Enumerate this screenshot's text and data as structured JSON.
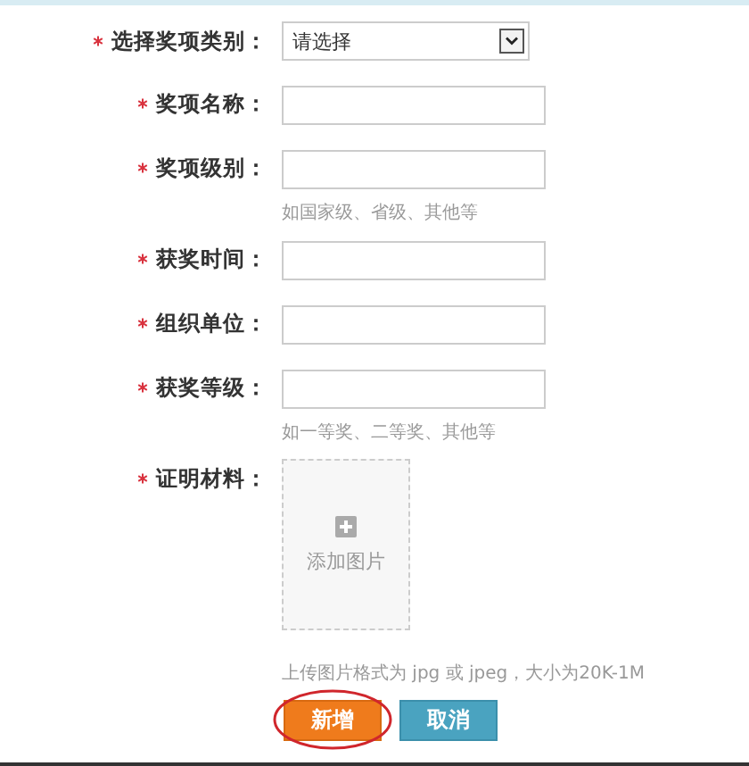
{
  "fields": [
    {
      "kind": "select",
      "label": "选择奖项类别：",
      "required": true,
      "value": "请选择"
    },
    {
      "kind": "text",
      "label": "奖项名称：",
      "required": true
    },
    {
      "kind": "text",
      "label": "奖项级别：",
      "required": true,
      "hint": "如国家级、省级、其他等"
    },
    {
      "kind": "text",
      "label": "获奖时间：",
      "required": true
    },
    {
      "kind": "text",
      "label": "组织单位：",
      "required": true
    },
    {
      "kind": "text",
      "label": "获奖等级：",
      "required": true,
      "hint": "如一等奖、二等奖、其他等"
    },
    {
      "kind": "upload",
      "label": "证明材料：",
      "required": true,
      "button": "添加图片"
    }
  ],
  "upload_hint": "上传图片格式为 jpg 或 jpeg，大小为20K-1M",
  "buttons": [
    {
      "label": "新增",
      "kind": "primary",
      "circled": true
    },
    {
      "label": "取消",
      "kind": "secondary",
      "circled": false
    }
  ]
}
